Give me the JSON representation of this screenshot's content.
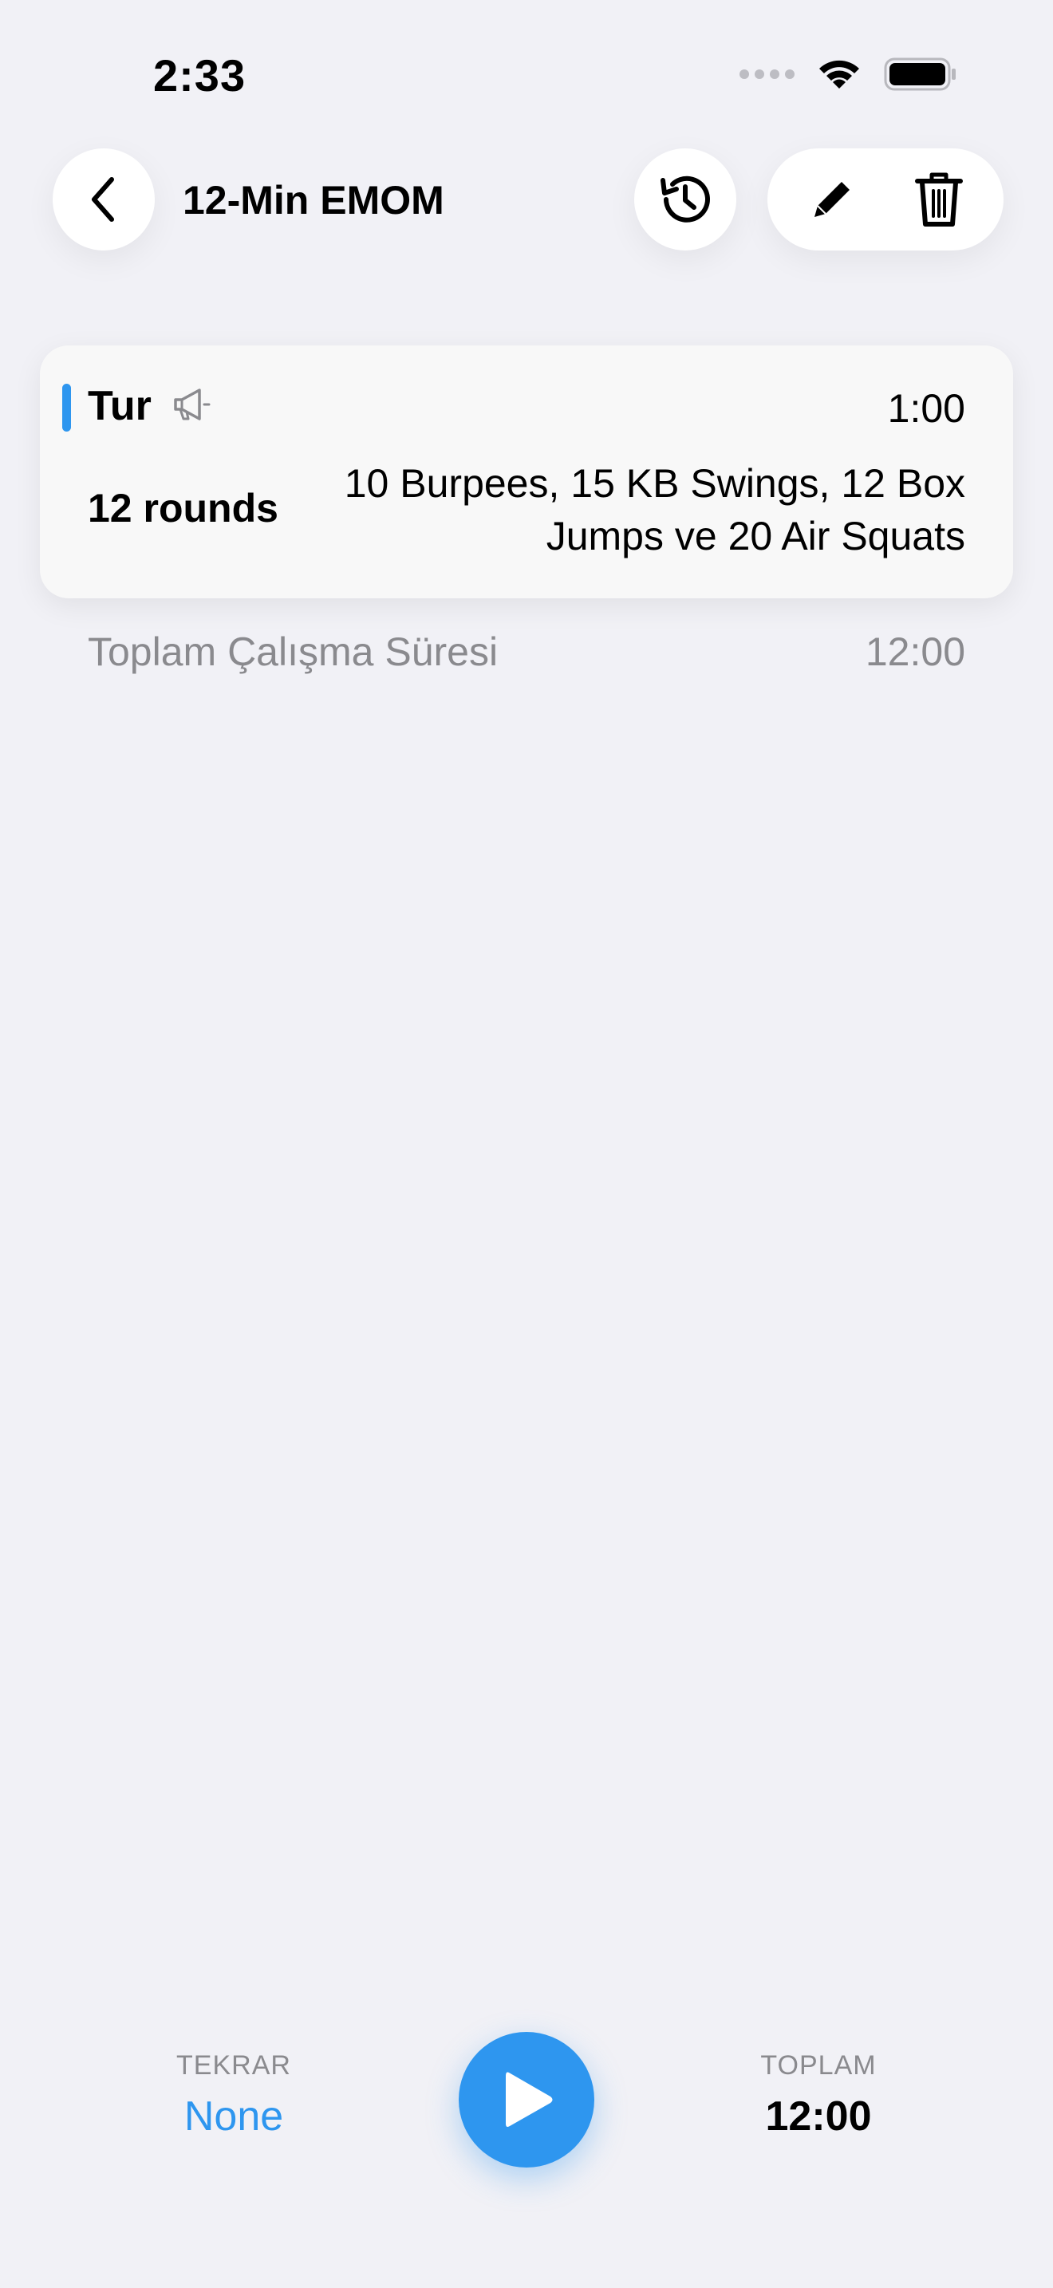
{
  "status_bar": {
    "time": "2:33"
  },
  "header": {
    "title": "12-Min EMOM",
    "icons": {
      "back": "chevron-left-icon",
      "history": "history-icon",
      "edit": "pencil-icon",
      "delete": "trash-icon"
    }
  },
  "card": {
    "type_label": "Tur",
    "duration": "1:00",
    "rounds": "12 rounds",
    "description": "10 Burpees, 15 KB Swings, 12 Box Jumps ve 20 Air Squats",
    "accent_color": "#2e96ef"
  },
  "summary": {
    "label": "Toplam Çalışma Süresi",
    "value": "12:00"
  },
  "footer": {
    "repeat_label": "TEKRAR",
    "repeat_value": "None",
    "total_label": "TOPLAM",
    "total_value": "12:00",
    "play_icon": "play-icon",
    "accent_color": "#2e96ef"
  }
}
